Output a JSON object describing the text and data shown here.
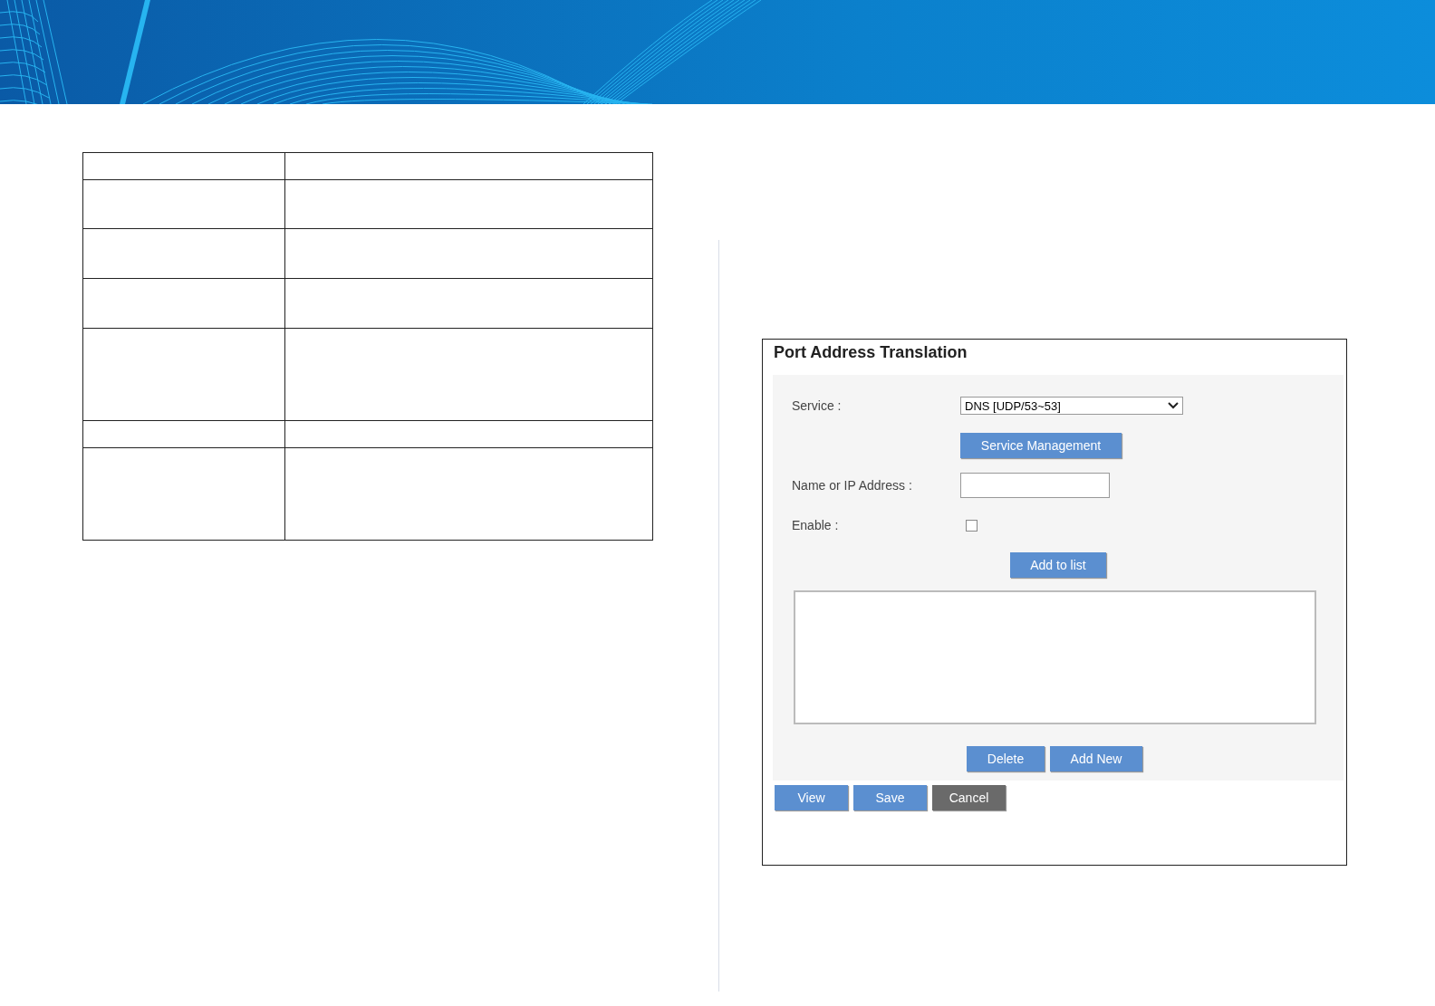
{
  "panel": {
    "title": "Port Address Translation",
    "fields": [
      {
        "kind": "select",
        "label": "Service :",
        "value": "DNS [UDP/53~53]"
      },
      {
        "kind": "button",
        "label": "Service Management"
      },
      {
        "kind": "text",
        "label": "Name or IP Address :"
      },
      {
        "kind": "checkbox",
        "label": "Enable :",
        "checked": false
      },
      {
        "kind": "button",
        "label": "Add to list"
      }
    ],
    "list_buttons": [
      "Delete",
      "Add New"
    ],
    "footer_buttons": [
      {
        "label": "View",
        "kind": "primary"
      },
      {
        "label": "Save",
        "kind": "primary"
      },
      {
        "label": "Cancel",
        "kind": "secondary"
      }
    ]
  }
}
